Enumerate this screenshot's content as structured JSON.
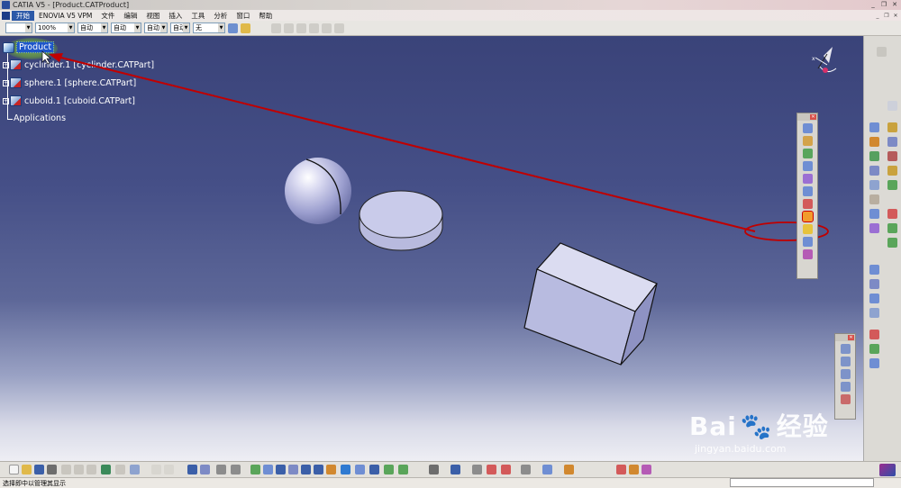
{
  "window": {
    "title": "CATIA V5 - [Product.CATProduct]"
  },
  "menu": {
    "items": [
      "开始",
      "ENOVIA V5 VPM",
      "文件",
      "编辑",
      "视图",
      "插入",
      "工具",
      "分析",
      "窗口",
      "帮助"
    ]
  },
  "toolbar": {
    "zoom_value": "100%",
    "linetype_value": "自动",
    "thickness_value": "自动",
    "layer_value": "自动",
    "layer2_value": "自动",
    "filter_value": "无"
  },
  "tree": {
    "root_label": "Product",
    "children": [
      {
        "label": "cyclinder.1 [cyclinder.CATPart]"
      },
      {
        "label": "sphere.1 [sphere.CATPart]"
      },
      {
        "label": "cuboid.1 [cuboid.CATPart]"
      }
    ],
    "applications_label": "Applications"
  },
  "status": {
    "message": "选择即中以管理其显示"
  },
  "watermark": {
    "text": "Bai",
    "brand": "经验",
    "url": "jingyan.baidu.com"
  },
  "colors": {
    "highlight_green": "#9bd12e",
    "arrow_red": "#c00000",
    "part_surface": "#c5c7e6",
    "selection_blue": "#1e56c9"
  }
}
